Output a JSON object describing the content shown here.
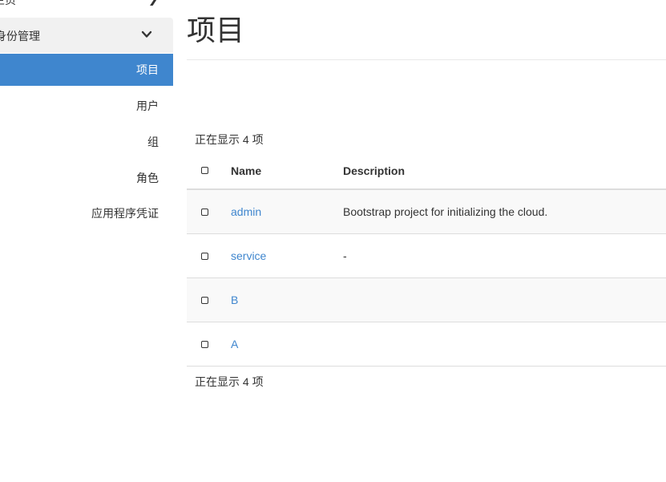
{
  "sidebar": {
    "top_label": "主页",
    "group_label": "身份管理",
    "items": [
      {
        "label": "项目",
        "active": true
      },
      {
        "label": "用户",
        "active": false
      },
      {
        "label": "组",
        "active": false
      },
      {
        "label": "角色",
        "active": false
      },
      {
        "label": "应用程序凭证",
        "active": false
      }
    ]
  },
  "main": {
    "title": "项目",
    "count_text": "正在显示 4 项",
    "table": {
      "headers": {
        "name": "Name",
        "description": "Description"
      },
      "rows": [
        {
          "name": "admin",
          "description": "Bootstrap project for initializing the cloud."
        },
        {
          "name": "service",
          "description": "-"
        },
        {
          "name": "B",
          "description": ""
        },
        {
          "name": "A",
          "description": ""
        }
      ]
    }
  },
  "colors": {
    "accent": "#3f86ce",
    "sidebar_group_bg": "#f1f1f1",
    "row_stripe": "#f9f9f9",
    "border": "#dddddd"
  }
}
